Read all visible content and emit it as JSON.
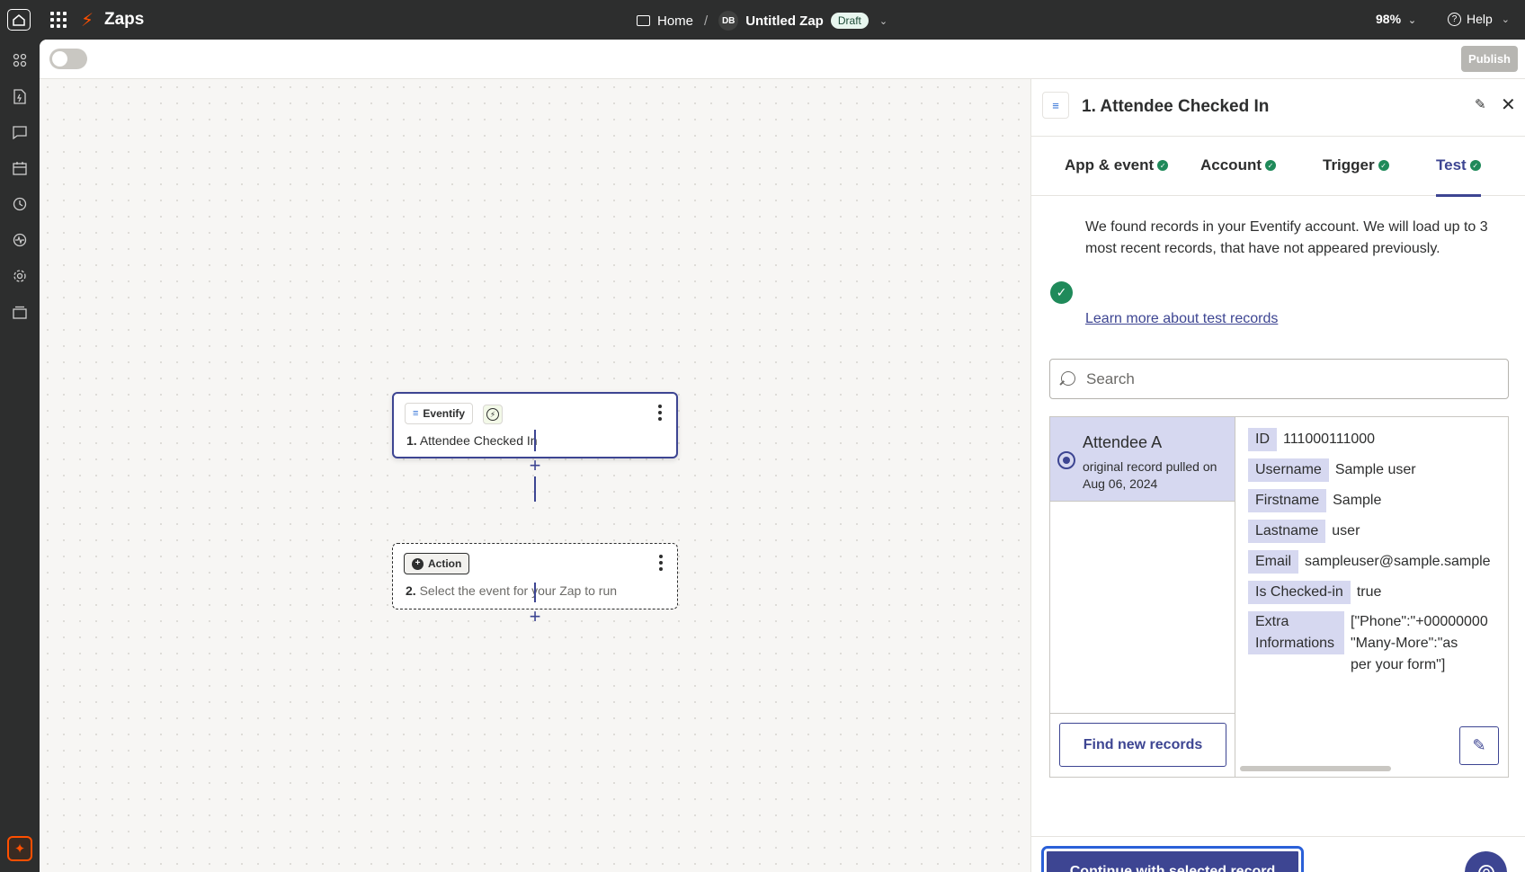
{
  "topbar": {
    "app_title": "Zaps",
    "breadcrumb_home": "Home",
    "breadcrumb_sep": "/",
    "avatar_initials": "DB",
    "zap_name": "Untitled Zap",
    "status_badge": "Draft",
    "zoom": "98%",
    "help": "Help"
  },
  "toolbar": {
    "publish": "Publish"
  },
  "sidebar": {
    "items": [
      "apps-icon",
      "zap-file-icon",
      "chat-icon",
      "calendar-icon",
      "history-icon",
      "activity-icon",
      "settings-icon",
      "archive-icon"
    ]
  },
  "canvas": {
    "trigger": {
      "app": "Eventify",
      "step_number": "1.",
      "title": "Attendee Checked In"
    },
    "action": {
      "chip": "Action",
      "step_number": "2.",
      "title": "Select the event for your Zap to run"
    }
  },
  "panel": {
    "title": "1. Attendee Checked In",
    "tabs": [
      {
        "label": "App & event"
      },
      {
        "label": "Account"
      },
      {
        "label": "Trigger"
      },
      {
        "label": "Test"
      }
    ],
    "found_message": "We found records in your Eventify account. We will load up to 3 most recent records, that have not appeared previously.",
    "learn_more": "Learn more about test records",
    "search_placeholder": "Search",
    "record": {
      "name": "Attendee A",
      "sub": "original record pulled on Aug 06, 2024"
    },
    "fields": [
      {
        "key": "ID",
        "value": "111000111000"
      },
      {
        "key": "Username",
        "value": "Sample user"
      },
      {
        "key": "Firstname",
        "value": "Sample"
      },
      {
        "key": "Lastname",
        "value": "user"
      },
      {
        "key": "Email",
        "value": "sampleuser@sample.sample"
      },
      {
        "key": "Is Checked-in",
        "value": "true"
      },
      {
        "key": "Extra Informations",
        "value": "[\"Phone\":\"+00000000\n\"Many-More\":\"as\nper your form\"]"
      }
    ],
    "find_new": "Find new records",
    "continue": "Continue with selected record"
  },
  "colors": {
    "accent": "#3d4592",
    "success": "#1f8a5a",
    "brand": "#ff4f00",
    "dark": "#2d2e2e"
  }
}
